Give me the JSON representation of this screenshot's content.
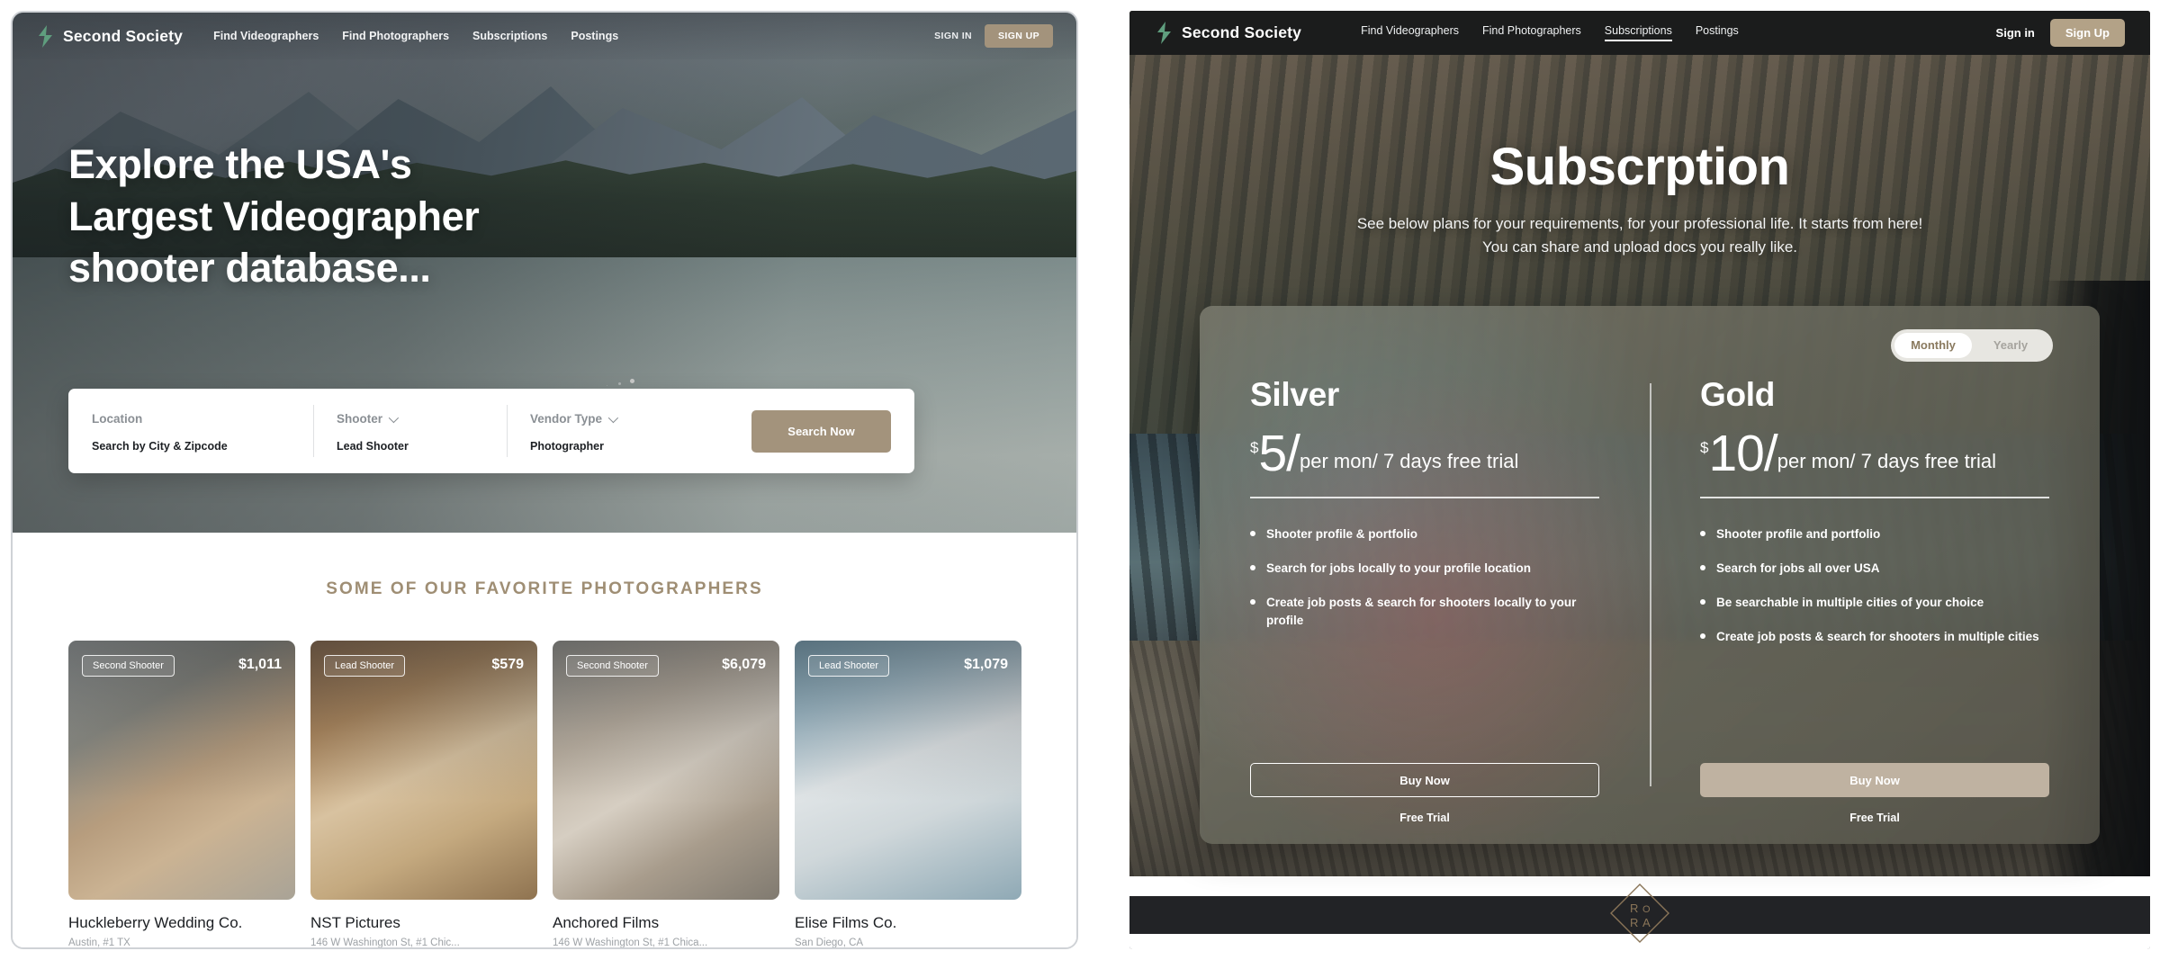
{
  "left": {
    "nav": {
      "brand": "Second Society",
      "logo_icon": "second-society-logo-icon",
      "links": [
        "Find Videographers",
        "Find Photographers",
        "Subscriptions",
        "Postings"
      ],
      "signin": "SIGN IN",
      "signup": "SIGN UP"
    },
    "hero": {
      "headline_lines": [
        "Explore the USA's",
        "Largest Videographer",
        "shooter database..."
      ]
    },
    "search": {
      "location_label": "Location",
      "location_value": "Search by City & Zipcode",
      "shooter_label": "Shooter",
      "shooter_value": "Lead Shooter",
      "vendor_label": "Vendor Type",
      "vendor_value": "Photographer",
      "button": "Search Now",
      "caret_icon": "chevron-down-icon"
    },
    "section_title": "SOME OF OUR FAVORITE PHOTOGRAPHERS",
    "cards": [
      {
        "badge": "Second Shooter",
        "price": "$1,011",
        "name": "Huckleberry Wedding Co.",
        "address": "Austin, #1 TX"
      },
      {
        "badge": "Lead Shooter",
        "price": "$579",
        "name": "NST Pictures",
        "address": "146 W Washington St, #1 Chic..."
      },
      {
        "badge": "Second Shooter",
        "price": "$6,079",
        "name": "Anchored Films",
        "address": "146 W Washington St, #1 Chica..."
      },
      {
        "badge": "Lead Shooter",
        "price": "$1,079",
        "name": "Elise Films Co.",
        "address": "San Diego, CA"
      }
    ]
  },
  "right": {
    "nav": {
      "brand": "Second Society",
      "logo_icon": "second-society-logo-icon",
      "links": [
        "Find Videographers",
        "Find Photographers",
        "Subscriptions",
        "Postings"
      ],
      "active_link": "Subscriptions",
      "signin": "Sign in",
      "signup": "Sign Up"
    },
    "hero": {
      "title": "Subscrption",
      "sub_line_1": "See below plans for your requirements, for your professional life. It starts from here!",
      "sub_line_2": "You can share and upload docs you really like."
    },
    "billing_toggle": {
      "monthly": "Monthly",
      "yearly": "Yearly",
      "selected": "Monthly"
    },
    "plans": [
      {
        "name": "Silver",
        "currency": "$",
        "amount": "5/",
        "period": "per mon/ 7 days free trial",
        "features": [
          "Shooter profile & portfolio",
          "Search for jobs locally to your profile location",
          "Create job posts & search for shooters locally to your profile"
        ],
        "buy": "Buy Now",
        "free": "Free Trial"
      },
      {
        "name": "Gold",
        "currency": "$",
        "amount": "10/",
        "period": "per mon/ 7 days free trial",
        "features": [
          "Shooter profile and portfolio",
          "Search for jobs all over USA",
          "Be searchable in multiple cities of your choice",
          "Create job posts & search for shooters in multiple cities"
        ],
        "buy": "Buy Now",
        "free": "Free Trial"
      }
    ],
    "footer": {
      "logo_icon": "rora-diamond-logo-icon",
      "logo_text_top": "R O",
      "logo_text_bottom": "R A"
    }
  },
  "colors": {
    "accent": "#a3937c",
    "accent_right": "#b3a287",
    "section_title": "#9f8e74",
    "dark_nav": "#1b1c1c"
  }
}
